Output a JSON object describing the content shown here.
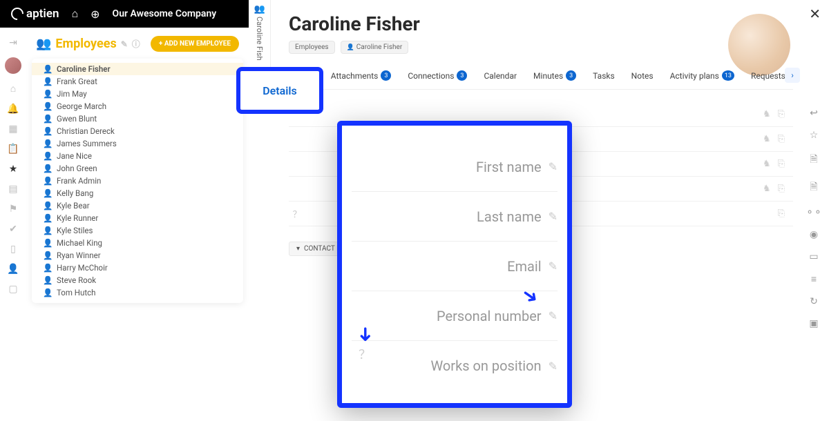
{
  "top": {
    "brand": "aptien",
    "company": "Our Awesome Company"
  },
  "vtab": {
    "label": "Caroline Fish"
  },
  "sidebar": {
    "title": "Employees",
    "add": "+ ADD NEW EMPLOYEE",
    "items": [
      {
        "name": "Caroline Fisher",
        "c": "y",
        "sel": true
      },
      {
        "name": "Frank Great",
        "c": "y"
      },
      {
        "name": "Jim May",
        "c": "y"
      },
      {
        "name": "George March",
        "c": "y"
      },
      {
        "name": "Gwen Blunt",
        "c": "y"
      },
      {
        "name": "Christian Dereck",
        "c": "b"
      },
      {
        "name": "James Summers",
        "c": "y"
      },
      {
        "name": "Jane Nice",
        "c": "y"
      },
      {
        "name": "John Green",
        "c": "b"
      },
      {
        "name": "Frank Admin",
        "c": "y"
      },
      {
        "name": "Kelly Bang",
        "c": "b"
      },
      {
        "name": "Kyle Bear",
        "c": "y"
      },
      {
        "name": "Kyle Runner",
        "c": "b"
      },
      {
        "name": "Kyle Stiles",
        "c": "y"
      },
      {
        "name": "Michael King",
        "c": "y"
      },
      {
        "name": "Ryan Winner",
        "c": "b"
      },
      {
        "name": "Harry McChoir",
        "c": "y"
      },
      {
        "name": "Steve Rook",
        "c": "y"
      },
      {
        "name": "Tom Hutch",
        "c": "y"
      }
    ]
  },
  "main": {
    "name": "Caroline Fisher",
    "crumbs": [
      "Employees",
      "Caroline Fisher"
    ],
    "tabs": [
      {
        "label": "Details"
      },
      {
        "label": "Attachments",
        "badge": "3"
      },
      {
        "label": "Connections",
        "badge": "3"
      },
      {
        "label": "Calendar"
      },
      {
        "label": "Minutes",
        "badge": "3"
      },
      {
        "label": "Tasks"
      },
      {
        "label": "Notes"
      },
      {
        "label": "Activity plans",
        "badge": "13"
      },
      {
        "label": "Requests"
      }
    ],
    "fields": [
      {
        "label": "",
        "help": false,
        "act": true
      },
      {
        "label": "",
        "help": false,
        "act": true
      },
      {
        "label": "",
        "help": false,
        "act": true
      },
      {
        "label": "Pe",
        "help": false,
        "act": true
      },
      {
        "label": "Wo",
        "help": true,
        "act": false
      }
    ],
    "accordion": "CONTACT D"
  },
  "zoom": {
    "details": "Details",
    "rows": [
      "First name",
      "Last name",
      "Email",
      "Personal number",
      "Works on position"
    ]
  }
}
